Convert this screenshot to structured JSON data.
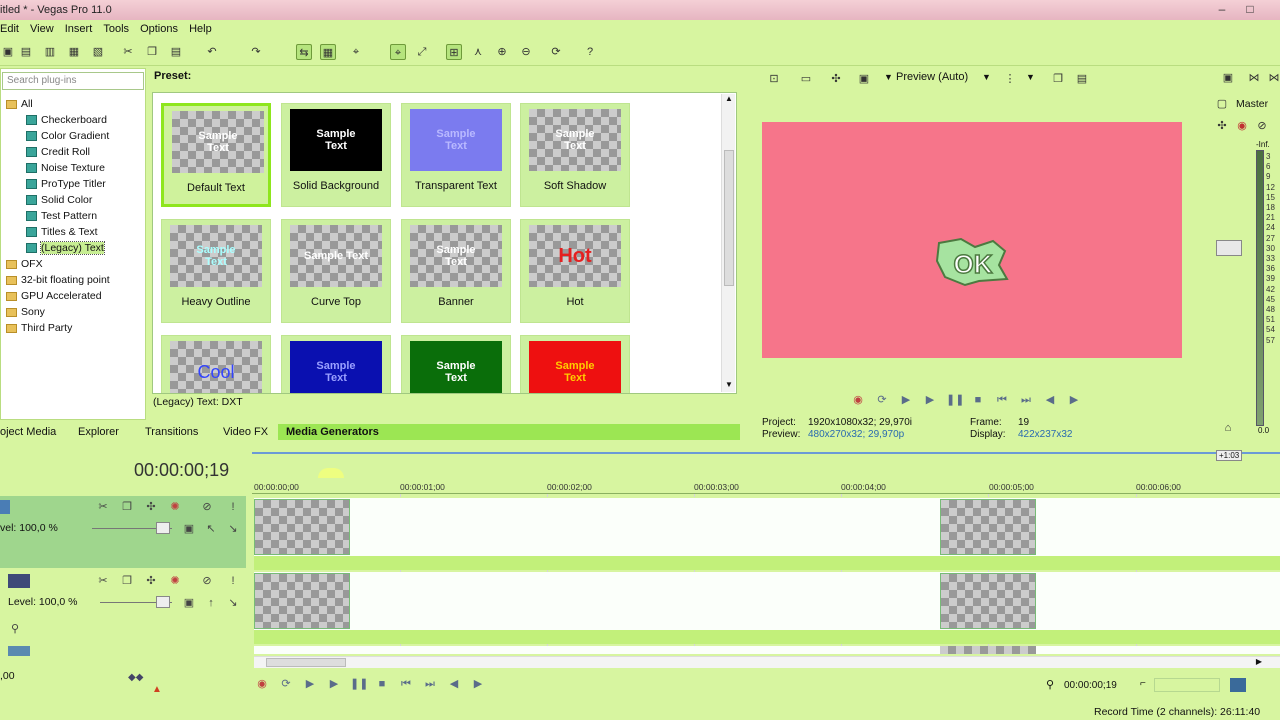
{
  "window": {
    "title": "itled * - Vegas Pro 11.0",
    "min": "–",
    "max": "□",
    "close": "✕"
  },
  "menu": [
    "Edit",
    "View",
    "Insert",
    "Tools",
    "Options",
    "Help"
  ],
  "plugins": {
    "search_placeholder": "Search plug-ins",
    "tree": [
      {
        "label": "All",
        "type": "folder",
        "level": 0
      },
      {
        "label": "Checkerboard",
        "type": "leaf",
        "level": 1
      },
      {
        "label": "Color Gradient",
        "type": "leaf",
        "level": 1
      },
      {
        "label": "Credit Roll",
        "type": "leaf",
        "level": 1
      },
      {
        "label": "Noise Texture",
        "type": "leaf",
        "level": 1
      },
      {
        "label": "ProType Titler",
        "type": "leaf",
        "level": 1
      },
      {
        "label": "Solid Color",
        "type": "leaf",
        "level": 1
      },
      {
        "label": "Test Pattern",
        "type": "leaf",
        "level": 1
      },
      {
        "label": "Titles & Text",
        "type": "leaf",
        "level": 1
      },
      {
        "label": "(Legacy) Text",
        "type": "leaf",
        "level": 1,
        "selected": true
      },
      {
        "label": "OFX",
        "type": "folder",
        "level": 0
      },
      {
        "label": "32-bit floating point",
        "type": "folder",
        "level": 0
      },
      {
        "label": "GPU Accelerated",
        "type": "folder",
        "level": 0
      },
      {
        "label": "Sony",
        "type": "folder",
        "level": 0
      },
      {
        "label": "Third Party",
        "type": "folder",
        "level": 0
      }
    ]
  },
  "presets": {
    "label": "Preset:",
    "status": "(Legacy) Text: DXT",
    "items": [
      {
        "name": "Default Text",
        "thumb": "Sample\nText",
        "bg": "checker",
        "fg": "#ffffff",
        "selected": true
      },
      {
        "name": "Solid Background",
        "thumb": "Sample\nText",
        "bg": "#000000",
        "fg": "#ffffff"
      },
      {
        "name": "Transparent Text",
        "thumb": "Sample\nText",
        "bg": "#7b7bef",
        "fg": "#b9b9ff"
      },
      {
        "name": "Soft Shadow",
        "thumb": "Sample\nText",
        "bg": "checker",
        "fg": "#ffffff"
      },
      {
        "name": "Heavy Outline",
        "thumb": "Sample\nText",
        "bg": "checker",
        "fg": "#aaffff"
      },
      {
        "name": "Curve Top",
        "thumb": "Sample Text",
        "bg": "checker",
        "fg": "#ffffff"
      },
      {
        "name": "Banner",
        "thumb": "Sample\nText",
        "bg": "checker",
        "fg": "#ffffff"
      },
      {
        "name": "Hot",
        "thumb": "Hot",
        "bg": "checker",
        "fg": "#e52020"
      },
      {
        "name": "",
        "thumb": "Cool",
        "bg": "checker",
        "fg": "#3344ff"
      },
      {
        "name": "",
        "thumb": "Sample\nText",
        "bg": "#0a10b0",
        "fg": "#9aa0ff"
      },
      {
        "name": "",
        "thumb": "Sample\nText",
        "bg": "#0a6e0a",
        "fg": "#ffffff"
      },
      {
        "name": "",
        "thumb": "Sample\nText",
        "bg": "#ee1010",
        "fg": "#ffcc00"
      }
    ]
  },
  "tabs": [
    "oject Media",
    "Explorer",
    "Transitions",
    "Video FX",
    "Media Generators"
  ],
  "active_tab": "Media Generators",
  "preview": {
    "mode": "Preview (Auto)",
    "canvas_color": "#f6758a",
    "overlay_text": "OK",
    "project_label": "Project:",
    "project_value": "1920x1080x32; 29,970i",
    "preview_label": "Preview:",
    "preview_value": "480x270x32; 29,970p",
    "frame_label": "Frame:",
    "frame_value": "19",
    "display_label": "Display:",
    "display_value": "422x237x32"
  },
  "mixer": {
    "label": "Master",
    "inf": "-Inf.",
    "scale": [
      "3",
      "6",
      "9",
      "12",
      "15",
      "18",
      "21",
      "24",
      "27",
      "30",
      "33",
      "36",
      "39",
      "42",
      "45",
      "48",
      "51",
      "54",
      "57"
    ],
    "bottom": "0.0"
  },
  "timeline": {
    "timecode": "00:00:00;19",
    "zoom_label": "+1:03",
    "ruler": [
      "00:00:00;00",
      "00:00:01;00",
      "00:00:02;00",
      "00:00:03;00",
      "00:00:04;00",
      "00:00:05;00",
      "00:00:06;00"
    ],
    "track1": {
      "level": "vel: 100,0 %"
    },
    "track2": {
      "level": "Level: 100,0 %"
    },
    "track3": {
      "level": ",00"
    },
    "position": "00:00:00;19"
  },
  "status": {
    "record_time": "Record Time (2 channels): 26:11:40"
  }
}
